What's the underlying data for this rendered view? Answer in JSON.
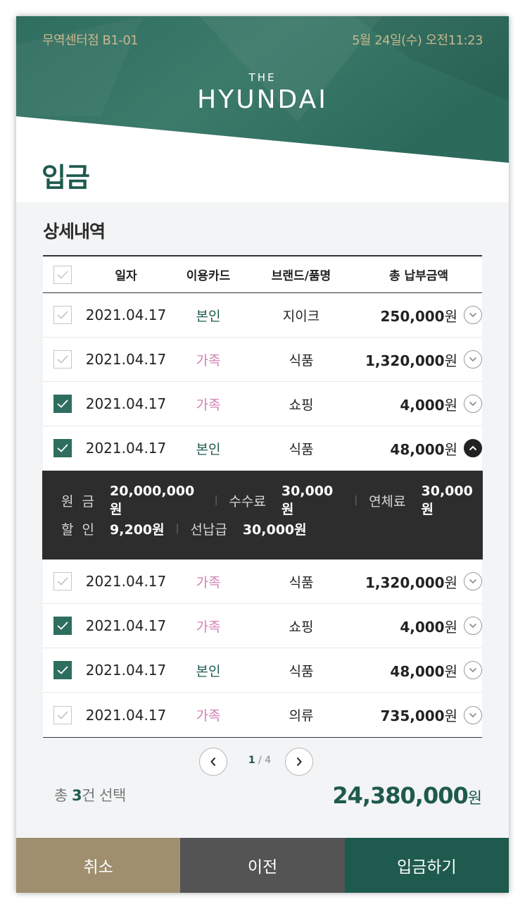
{
  "header": {
    "store": "무역센터점 B1-01",
    "datetime": "5월 24일(수) 오전11:23",
    "logo_top": "THE",
    "logo_main": "HYUNDAI"
  },
  "page_title": "입금",
  "section_title": "상세내역",
  "table": {
    "columns": [
      "일자",
      "이용카드",
      "브랜드/품명",
      "총 납부금액"
    ],
    "rows": [
      {
        "checked": false,
        "date": "2021.04.17",
        "card": "본인",
        "brand": "지이크",
        "amount": "250,000",
        "unit": "원",
        "expanded": false
      },
      {
        "checked": false,
        "date": "2021.04.17",
        "card": "가족",
        "brand": "식품",
        "amount": "1,320,000",
        "unit": "원",
        "expanded": false
      },
      {
        "checked": true,
        "date": "2021.04.17",
        "card": "가족",
        "brand": "쇼핑",
        "amount": "4,000",
        "unit": "원",
        "expanded": false
      },
      {
        "checked": true,
        "date": "2021.04.17",
        "card": "본인",
        "brand": "식품",
        "amount": "48,000",
        "unit": "원",
        "expanded": true
      },
      {
        "checked": false,
        "date": "2021.04.17",
        "card": "가족",
        "brand": "식품",
        "amount": "1,320,000",
        "unit": "원",
        "expanded": false
      },
      {
        "checked": true,
        "date": "2021.04.17",
        "card": "가족",
        "brand": "쇼핑",
        "amount": "4,000",
        "unit": "원",
        "expanded": false
      },
      {
        "checked": true,
        "date": "2021.04.17",
        "card": "본인",
        "brand": "식품",
        "amount": "48,000",
        "unit": "원",
        "expanded": false
      },
      {
        "checked": false,
        "date": "2021.04.17",
        "card": "가족",
        "brand": "의류",
        "amount": "735,000",
        "unit": "원",
        "expanded": false
      }
    ],
    "detail": {
      "line1": [
        {
          "label": "원  금",
          "value": "20,000,000원"
        },
        {
          "label": "수수료",
          "value": "30,000원"
        },
        {
          "label": "연체료",
          "value": "30,000원"
        }
      ],
      "line2": [
        {
          "label": "할  인",
          "value": "9,200원"
        },
        {
          "label": "선납급",
          "value": "30,000원"
        }
      ]
    }
  },
  "pagination": {
    "current": "1",
    "separator": "/",
    "total": "4"
  },
  "summary": {
    "prefix": "총 ",
    "count": "3",
    "suffix": "건 선택",
    "total": "24,380,000",
    "unit": "원"
  },
  "buttons": {
    "cancel": "취소",
    "prev": "이전",
    "deposit": "입금하기"
  },
  "colors": {
    "primary": "#1e5a4d",
    "family": "#d283b4",
    "gold": "#c9b68d",
    "cancel": "#9f8f6f",
    "prev": "#545454"
  },
  "icons": {
    "check": "check-icon",
    "chevron_down": "chevron-down-icon",
    "chevron_up": "chevron-up-icon",
    "prev": "chevron-left-icon",
    "next": "chevron-right-icon"
  }
}
